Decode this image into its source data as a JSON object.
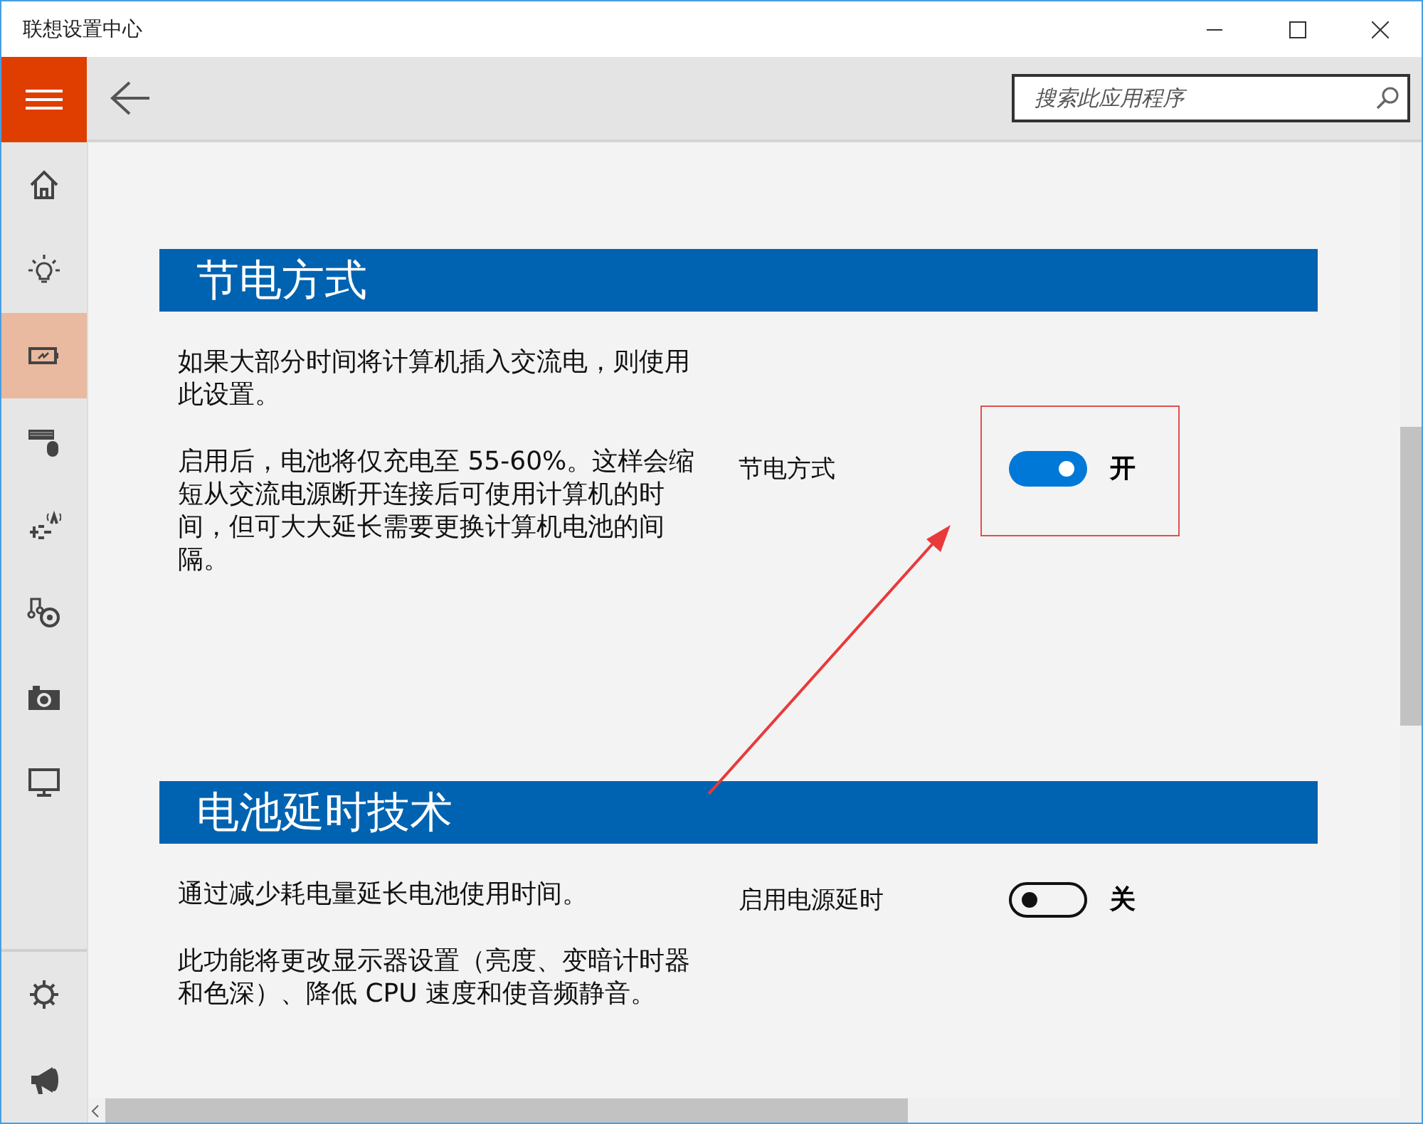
{
  "window": {
    "title": "联想设置中心"
  },
  "search": {
    "placeholder": "搜索此应用程序"
  },
  "sidebar": {
    "items": [
      {
        "kind": "home",
        "selected": false
      },
      {
        "kind": "bulb",
        "selected": false
      },
      {
        "kind": "battery",
        "selected": true
      },
      {
        "kind": "keyboard",
        "selected": false
      },
      {
        "kind": "network",
        "selected": false
      },
      {
        "kind": "media",
        "selected": false
      },
      {
        "kind": "camera",
        "selected": false
      },
      {
        "kind": "monitor",
        "selected": false
      }
    ],
    "bottom_items": [
      {
        "kind": "gear",
        "selected": false
      },
      {
        "kind": "megaphone",
        "selected": false
      }
    ]
  },
  "sections": [
    {
      "title": "节电方式",
      "paragraphs": [
        "如果大部分时间将计算机插入交流电，则使用此设置。",
        "启用后，电池将仅充电至 55-60%。这样会缩短从交流电源断开连接后可使用计算机的时间，但可大大延长需要更换计算机电池的间隔。"
      ],
      "setting": {
        "label": "节电方式",
        "on": true,
        "state_text": "开"
      }
    },
    {
      "title": "电池延时技术",
      "paragraphs": [
        "通过减少耗电量延长电池使用时间。",
        "此功能将更改显示器设置（亮度、变暗计时器和色深）、降低 CPU 速度和使音频静音。"
      ],
      "setting": {
        "label": "启用电源延时",
        "on": false,
        "state_text": "关"
      }
    }
  ]
}
